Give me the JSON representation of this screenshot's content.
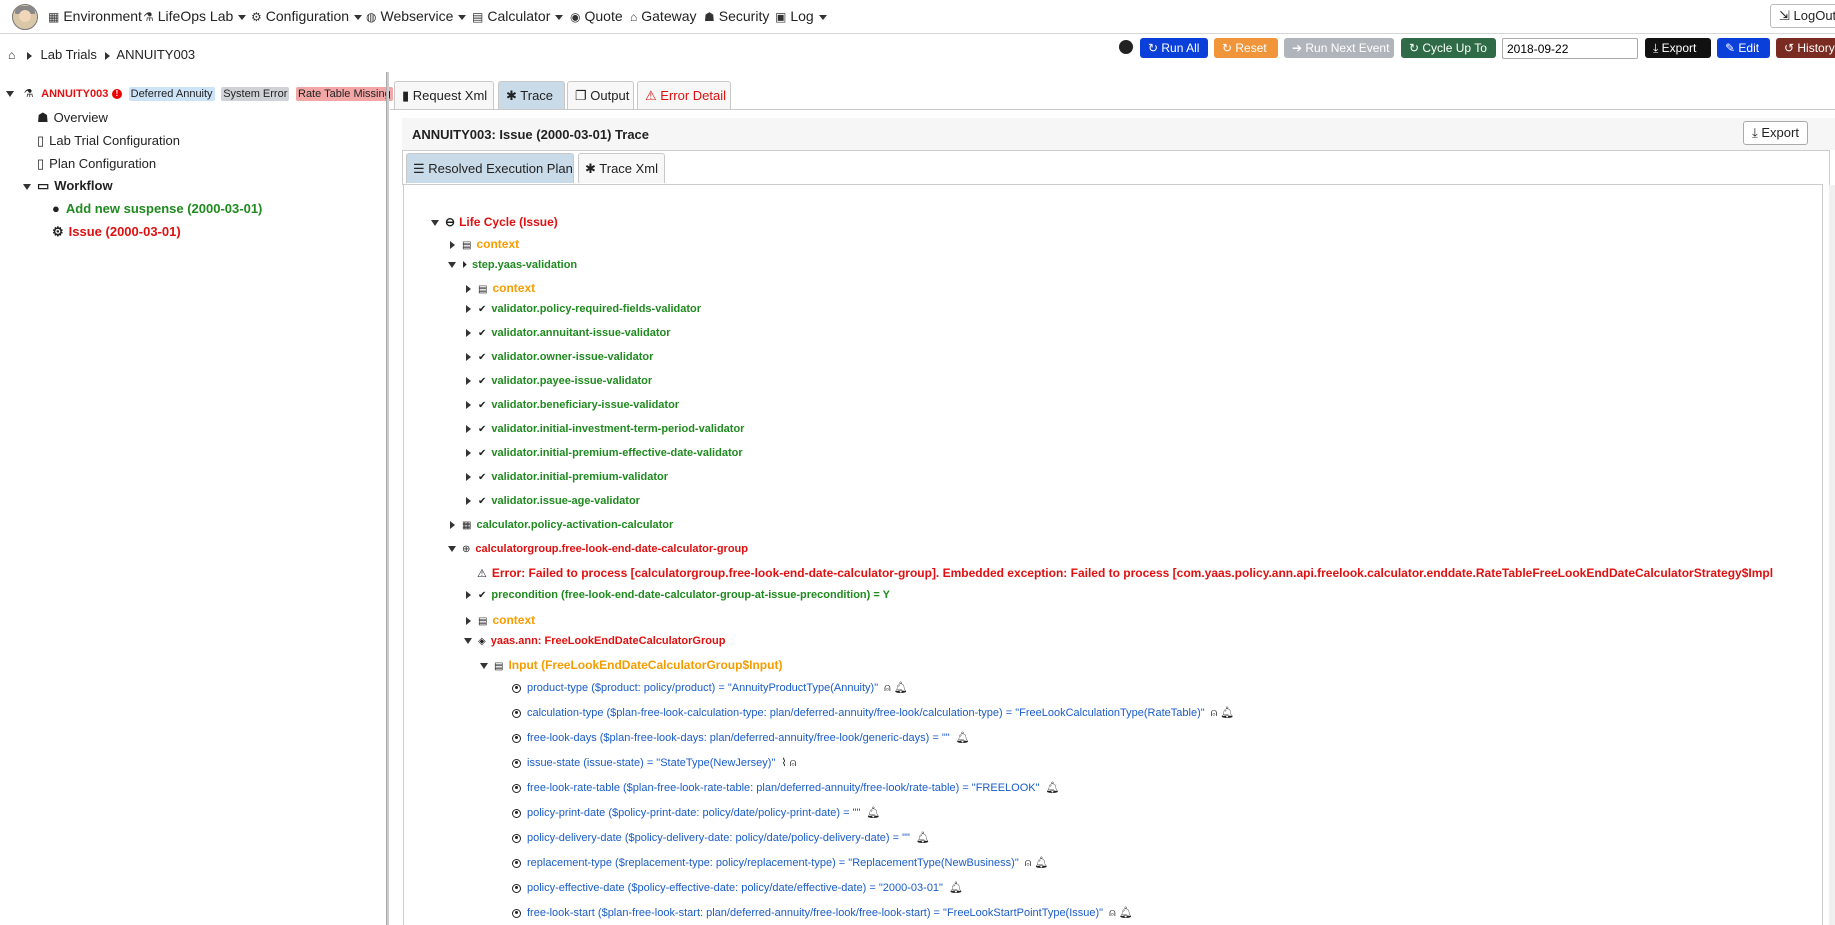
{
  "nav": {
    "items": [
      {
        "label": "Environment",
        "icon": "calendar-icon",
        "dropdown": false
      },
      {
        "label": "LifeOps Lab",
        "icon": "flask-icon",
        "dropdown": true
      },
      {
        "label": "Configuration",
        "icon": "gears-icon",
        "dropdown": true
      },
      {
        "label": "Webservice",
        "icon": "globe-icon",
        "dropdown": true
      },
      {
        "label": "Calculator",
        "icon": "calculator-icon",
        "dropdown": true
      },
      {
        "label": "Quote",
        "icon": "eye-icon",
        "dropdown": false
      },
      {
        "label": "Gateway",
        "icon": "bank-icon",
        "dropdown": false
      },
      {
        "label": "Security",
        "icon": "users-icon",
        "dropdown": false
      },
      {
        "label": "Log",
        "icon": "log-icon",
        "dropdown": true
      }
    ],
    "logout": "LogOut"
  },
  "breadcrumb": {
    "items": [
      "Lab Trials",
      "ANNUITY003"
    ]
  },
  "toolbar": {
    "run_all": "Run All",
    "reset": "Reset",
    "run_next": "Run Next Event",
    "cycle_up_to": "Cycle Up To",
    "date": "2018-09-22",
    "export": "Export",
    "edit": "Edit",
    "history": "History"
  },
  "tree": {
    "root": "ANNUITY003",
    "badges": [
      "Deferred Annuity",
      "System Error",
      "Rate Table Missing"
    ],
    "overview": "Overview",
    "lab_trial_config": "Lab Trial Configuration",
    "plan_config": "Plan Configuration",
    "workflow": "Workflow",
    "event1": "Add new suspense (2000-03-01)",
    "event2": "Issue (2000-03-01)"
  },
  "tabs": {
    "request_xml": "Request Xml",
    "trace": "Trace",
    "output": "Output",
    "error_detail": "Error Detail"
  },
  "trace": {
    "title": "ANNUITY003: Issue (2000-03-01) Trace",
    "export": "Export",
    "tab_plan": "Resolved Execution Plan",
    "tab_xml": "Trace Xml",
    "lifecycle": "Life Cycle (Issue)",
    "context": "context",
    "step": "step.yaas-validation",
    "validators": [
      "validator.policy-required-fields-validator",
      "validator.annuitant-issue-validator",
      "validator.owner-issue-validator",
      "validator.payee-issue-validator",
      "validator.beneficiary-issue-validator",
      "validator.initial-investment-term-period-validator",
      "validator.initial-premium-effective-date-validator",
      "validator.initial-premium-validator",
      "validator.issue-age-validator"
    ],
    "calculator": "calculator.policy-activation-calculator",
    "calcgroup": "calculatorgroup.free-look-end-date-calculator-group",
    "error": "Error: Failed to process [calculatorgroup.free-look-end-date-calculator-group]. Embedded exception: Failed to process [com.yaas.policy.ann.api.freelook.calculator.enddate.RateTableFreeLookEndDateCalculatorStrategy$Impl",
    "precondition": "precondition (free-look-end-date-calculator-group-at-issue-precondition) = Y",
    "ann": "yaas.ann: FreeLookEndDateCalculatorGroup",
    "input": "Input (FreeLookEndDateCalculatorGroup$Input)",
    "inputs": [
      {
        "text": "product-type ($product: policy/product) = \"AnnuityProductType(Annuity)\"",
        "icons": [
          "user-search-icon",
          "bell-icon"
        ]
      },
      {
        "text": "calculation-type ($plan-free-look-calculation-type: plan/deferred-annuity/free-look/calculation-type) = \"FreeLookCalculationType(RateTable)\"",
        "icons": [
          "user-search-icon",
          "bell-icon"
        ]
      },
      {
        "text": "free-look-days ($plan-free-look-days: plan/deferred-annuity/free-look/generic-days) = \"\"",
        "icons": [
          "bell-icon"
        ]
      },
      {
        "text": "issue-state (issue-state) = \"StateType(NewJersey)\"",
        "icons": [
          "broom-icon",
          "user-search-icon"
        ]
      },
      {
        "text": "free-look-rate-table ($plan-free-look-rate-table: plan/deferred-annuity/free-look/rate-table) = \"FREELOOK\"",
        "icons": [
          "bell-icon"
        ]
      },
      {
        "text": "policy-print-date ($policy-print-date: policy/date/policy-print-date) = \"\"",
        "icons": [
          "bell-icon"
        ]
      },
      {
        "text": "policy-delivery-date ($policy-delivery-date: policy/date/policy-delivery-date) = \"\"",
        "icons": [
          "bell-icon"
        ]
      },
      {
        "text": "replacement-type ($replacement-type: policy/replacement-type) = \"ReplacementType(NewBusiness)\"",
        "icons": [
          "user-search-icon",
          "bell-icon"
        ]
      },
      {
        "text": "policy-effective-date ($policy-effective-date: policy/date/effective-date) = \"2000-03-01\"",
        "icons": [
          "bell-icon"
        ]
      },
      {
        "text": "free-look-start ($plan-free-look-start: plan/deferred-annuity/free-look/free-look-start) = \"FreeLookStartPointType(Issue)\"",
        "icons": [
          "user-search-icon",
          "bell-icon"
        ]
      }
    ]
  },
  "colors": {
    "green": "#1f8a1f",
    "red": "#e01010",
    "orange": "#f59d00",
    "blue": "#1a5cc8",
    "run_all": "#0b3fd9",
    "reset": "#f0953a",
    "run_next": "#b0b4bb",
    "cycle": "#2e6b46",
    "export": "#111111",
    "edit": "#0b3fd9",
    "history": "#7a2b22"
  }
}
